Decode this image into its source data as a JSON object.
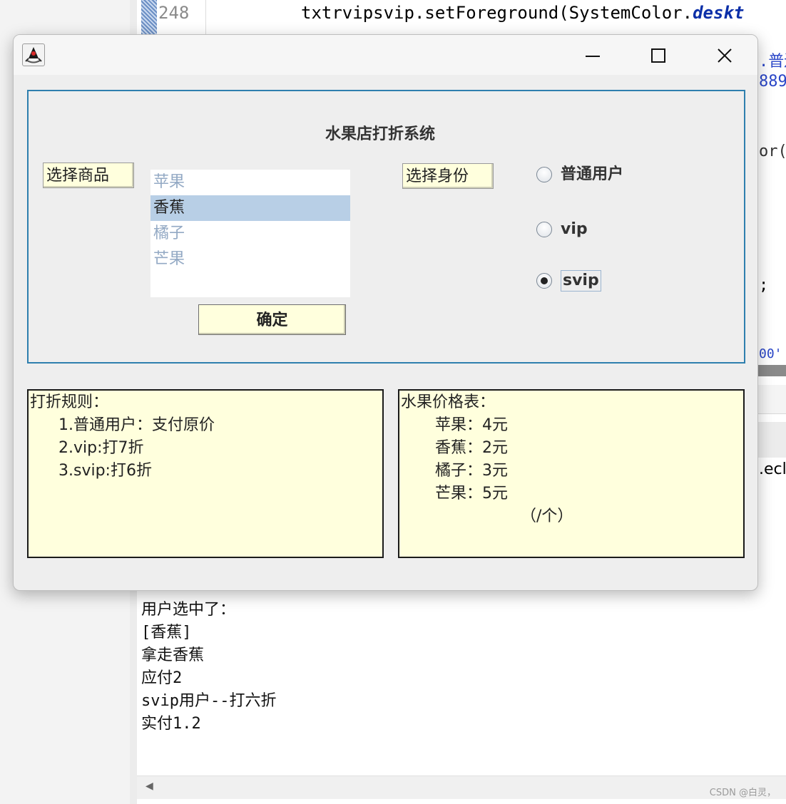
{
  "ide": {
    "line_number": "248",
    "code_top_prefix": "txtrvipsvip.setForeground(SystemColor.",
    "code_top_keyword": "deskt",
    "side_fragments": [
      ".普边",
      "889",
      "or(",
      ";",
      "00'",
      ".ecl"
    ],
    "console_lines": [
      "用户选中了：",
      "[香蕉]",
      "拿走香蕉",
      "应付2",
      "svip用户--打六折",
      "实付1.2"
    ],
    "watermark": "CSDN @白灵，"
  },
  "window": {
    "title_icon": "java-duke-icon",
    "minimize_icon": "minimize-icon",
    "maximize_icon": "maximize-icon",
    "close_icon": "close-icon",
    "system_title": "水果店打折系统",
    "select_goods_label": "选择商品",
    "select_identity_label": "选择身份",
    "goods_list": [
      {
        "label": "苹果",
        "selected": false
      },
      {
        "label": "香蕉",
        "selected": true
      },
      {
        "label": "橘子",
        "selected": false
      },
      {
        "label": "芒果",
        "selected": false
      }
    ],
    "confirm_button": "确定",
    "identity_options": [
      {
        "label": "普通用户",
        "checked": false
      },
      {
        "label": "vip",
        "checked": false
      },
      {
        "label": "svip",
        "checked": true
      }
    ],
    "rules": {
      "title": "打折规则：",
      "lines": [
        "1.普通用户：支付原价",
        "2.vip:打7折",
        "3.svip:打6折"
      ]
    },
    "prices": {
      "title": "水果价格表：",
      "lines": [
        "苹果：4元",
        "香蕉：2元",
        "橘子：3元",
        "芒果：5元"
      ],
      "unit": "（/个）"
    }
  }
}
